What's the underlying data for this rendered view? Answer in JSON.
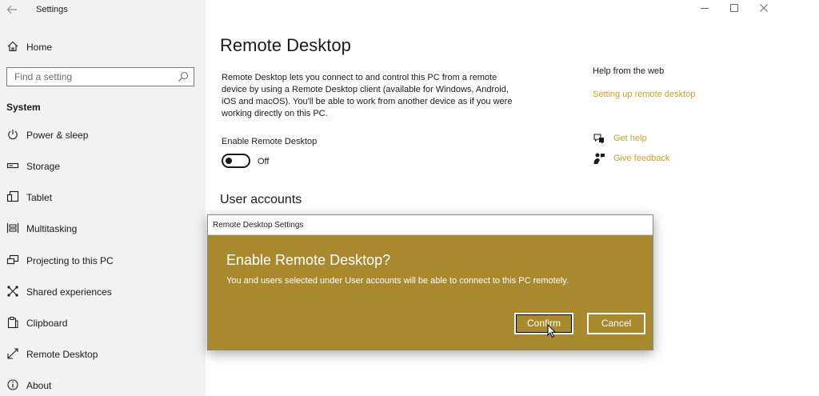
{
  "window": {
    "app_title": "Settings",
    "back_icon": "arrow-left-icon",
    "controls": [
      "minimize-icon",
      "maximize-icon",
      "close-icon"
    ]
  },
  "sidebar": {
    "home_label": "Home",
    "search_placeholder": "Find a setting",
    "section_header": "System",
    "items": [
      {
        "label": "Power & sleep",
        "icon": "power-icon"
      },
      {
        "label": "Storage",
        "icon": "storage-icon"
      },
      {
        "label": "Tablet",
        "icon": "tablet-icon"
      },
      {
        "label": "Multitasking",
        "icon": "multitasking-icon"
      },
      {
        "label": "Projecting to this PC",
        "icon": "projecting-icon"
      },
      {
        "label": "Shared experiences",
        "icon": "shared-experiences-icon"
      },
      {
        "label": "Clipboard",
        "icon": "clipboard-icon"
      },
      {
        "label": "Remote Desktop",
        "icon": "remote-desktop-icon"
      },
      {
        "label": "About",
        "icon": "info-icon"
      }
    ]
  },
  "main": {
    "title": "Remote Desktop",
    "description": "Remote Desktop lets you connect to and control this PC from a remote device by using a Remote Desktop client (available for Windows, Android, iOS and macOS). You'll be able to work from another device as if you were working directly on this PC.",
    "enable_label": "Enable Remote Desktop",
    "toggle_state": "Off",
    "user_accounts_title": "User accounts"
  },
  "help": {
    "title": "Help from the web",
    "link": "Setting up remote desktop",
    "get_help": "Get help",
    "give_feedback": "Give feedback"
  },
  "dialog": {
    "titlebar": "Remote Desktop Settings",
    "heading": "Enable Remote Desktop?",
    "body": "You and users selected under User accounts will be able to connect to this PC remotely.",
    "confirm_label": "Confirm",
    "cancel_label": "Cancel"
  },
  "colors": {
    "accent": "#c9a227",
    "dialog_bg": "#a9892d",
    "sidebar_bg": "#f2f2f2"
  }
}
